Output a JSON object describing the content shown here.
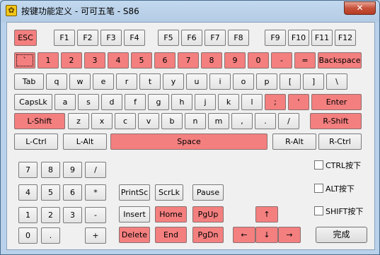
{
  "window": {
    "title": "按键功能定义 - 可可五笔 - S86",
    "app_icon": "gear-icon",
    "close_icon": "close-icon",
    "close_glyph": "✕"
  },
  "colors": {
    "highlight": "#f47f7f",
    "client_bg": "#f0f0f0"
  },
  "keys": [
    {
      "id": "esc",
      "label": "ESC",
      "hl": true
    },
    {
      "id": "f1",
      "label": "F1",
      "hl": false
    },
    {
      "id": "f2",
      "label": "F2",
      "hl": false
    },
    {
      "id": "f3",
      "label": "F3",
      "hl": false
    },
    {
      "id": "f4",
      "label": "F4",
      "hl": false
    },
    {
      "id": "f5",
      "label": "F5",
      "hl": false
    },
    {
      "id": "f6",
      "label": "F6",
      "hl": false
    },
    {
      "id": "f7",
      "label": "F7",
      "hl": false
    },
    {
      "id": "f8",
      "label": "F8",
      "hl": false
    },
    {
      "id": "f9",
      "label": "F9",
      "hl": false
    },
    {
      "id": "f10",
      "label": "F10",
      "hl": false
    },
    {
      "id": "f11",
      "label": "F11",
      "hl": false
    },
    {
      "id": "f12",
      "label": "F12",
      "hl": false
    },
    {
      "id": "backtick",
      "label": "`",
      "hl": true,
      "focus": true
    },
    {
      "id": "1",
      "label": "1",
      "hl": true
    },
    {
      "id": "2",
      "label": "2",
      "hl": true
    },
    {
      "id": "3",
      "label": "3",
      "hl": true
    },
    {
      "id": "4",
      "label": "4",
      "hl": true
    },
    {
      "id": "5",
      "label": "5",
      "hl": true
    },
    {
      "id": "6",
      "label": "6",
      "hl": true
    },
    {
      "id": "7",
      "label": "7",
      "hl": true
    },
    {
      "id": "8",
      "label": "8",
      "hl": true
    },
    {
      "id": "9",
      "label": "9",
      "hl": true
    },
    {
      "id": "0",
      "label": "0",
      "hl": true
    },
    {
      "id": "minus",
      "label": "-",
      "hl": true
    },
    {
      "id": "equals",
      "label": "=",
      "hl": true
    },
    {
      "id": "backspace",
      "label": "Backspace",
      "hl": true
    },
    {
      "id": "tab",
      "label": "Tab",
      "hl": false
    },
    {
      "id": "q",
      "label": "q",
      "hl": false
    },
    {
      "id": "w",
      "label": "w",
      "hl": false
    },
    {
      "id": "e",
      "label": "e",
      "hl": false
    },
    {
      "id": "r",
      "label": "r",
      "hl": false
    },
    {
      "id": "t",
      "label": "t",
      "hl": false
    },
    {
      "id": "y",
      "label": "y",
      "hl": false
    },
    {
      "id": "u",
      "label": "u",
      "hl": false
    },
    {
      "id": "i",
      "label": "i",
      "hl": false
    },
    {
      "id": "o",
      "label": "o",
      "hl": false
    },
    {
      "id": "p",
      "label": "p",
      "hl": false
    },
    {
      "id": "lbracket",
      "label": "[",
      "hl": false
    },
    {
      "id": "rbracket",
      "label": "]",
      "hl": false
    },
    {
      "id": "backslash",
      "label": "\\",
      "hl": false
    },
    {
      "id": "capslock",
      "label": "CapsLk",
      "hl": false
    },
    {
      "id": "a",
      "label": "a",
      "hl": false
    },
    {
      "id": "s",
      "label": "s",
      "hl": false
    },
    {
      "id": "d",
      "label": "d",
      "hl": false
    },
    {
      "id": "f",
      "label": "f",
      "hl": false
    },
    {
      "id": "g",
      "label": "g",
      "hl": false
    },
    {
      "id": "h",
      "label": "h",
      "hl": false
    },
    {
      "id": "j",
      "label": "j",
      "hl": false
    },
    {
      "id": "k",
      "label": "k",
      "hl": false
    },
    {
      "id": "l",
      "label": "l",
      "hl": false
    },
    {
      "id": "semicolon",
      "label": ";",
      "hl": true
    },
    {
      "id": "quote",
      "label": "'",
      "hl": true
    },
    {
      "id": "enter",
      "label": "Enter",
      "hl": true
    },
    {
      "id": "lshift",
      "label": "L-Shift",
      "hl": true
    },
    {
      "id": "z",
      "label": "z",
      "hl": false
    },
    {
      "id": "x",
      "label": "x",
      "hl": false
    },
    {
      "id": "c",
      "label": "c",
      "hl": false
    },
    {
      "id": "v",
      "label": "v",
      "hl": false
    },
    {
      "id": "b",
      "label": "b",
      "hl": false
    },
    {
      "id": "n",
      "label": "n",
      "hl": false
    },
    {
      "id": "m",
      "label": "m",
      "hl": false
    },
    {
      "id": "comma",
      "label": ",",
      "hl": false
    },
    {
      "id": "period",
      "label": ".",
      "hl": false
    },
    {
      "id": "slash",
      "label": "/",
      "hl": false
    },
    {
      "id": "rshift",
      "label": "R-Shift",
      "hl": true
    },
    {
      "id": "lctrl",
      "label": "L-Ctrl",
      "hl": false
    },
    {
      "id": "lalt",
      "label": "L-Alt",
      "hl": false
    },
    {
      "id": "space",
      "label": "Space",
      "hl": true
    },
    {
      "id": "ralt",
      "label": "R-Alt",
      "hl": false
    },
    {
      "id": "rctrl",
      "label": "R-Ctrl",
      "hl": false
    },
    {
      "id": "num7",
      "label": "7",
      "hl": false
    },
    {
      "id": "num8",
      "label": "8",
      "hl": false
    },
    {
      "id": "num9",
      "label": "9",
      "hl": false
    },
    {
      "id": "numslash",
      "label": "/",
      "hl": false
    },
    {
      "id": "num4",
      "label": "4",
      "hl": false
    },
    {
      "id": "num5",
      "label": "5",
      "hl": false
    },
    {
      "id": "num6",
      "label": "6",
      "hl": false
    },
    {
      "id": "numstar",
      "label": "*",
      "hl": false
    },
    {
      "id": "num1",
      "label": "1",
      "hl": false
    },
    {
      "id": "num2",
      "label": "2",
      "hl": false
    },
    {
      "id": "num3",
      "label": "3",
      "hl": false
    },
    {
      "id": "numminus",
      "label": "-",
      "hl": false
    },
    {
      "id": "num0",
      "label": "0",
      "hl": false
    },
    {
      "id": "numdot",
      "label": ".",
      "hl": false
    },
    {
      "id": "numplus",
      "label": "+",
      "hl": false
    },
    {
      "id": "printsc",
      "label": "PrintSc",
      "hl": false
    },
    {
      "id": "scrlk",
      "label": "ScrLk",
      "hl": false
    },
    {
      "id": "pause",
      "label": "Pause",
      "hl": false
    },
    {
      "id": "insert",
      "label": "Insert",
      "hl": false
    },
    {
      "id": "home",
      "label": "Home",
      "hl": true
    },
    {
      "id": "pgup",
      "label": "PgUp",
      "hl": true
    },
    {
      "id": "delete",
      "label": "Delete",
      "hl": true
    },
    {
      "id": "end",
      "label": "End",
      "hl": true
    },
    {
      "id": "pgdn",
      "label": "PgDn",
      "hl": true
    },
    {
      "id": "up",
      "label": "↑",
      "hl": true
    },
    {
      "id": "left",
      "label": "←",
      "hl": true
    },
    {
      "id": "down",
      "label": "↓",
      "hl": true
    },
    {
      "id": "right",
      "label": "→",
      "hl": true
    }
  ],
  "checkboxes": [
    {
      "id": "ctrl",
      "label": "CTRL按下",
      "checked": false
    },
    {
      "id": "alt",
      "label": "ALT按下",
      "checked": false
    },
    {
      "id": "shift",
      "label": "SHIFT按下",
      "checked": false
    }
  ],
  "ok_button": "完成"
}
